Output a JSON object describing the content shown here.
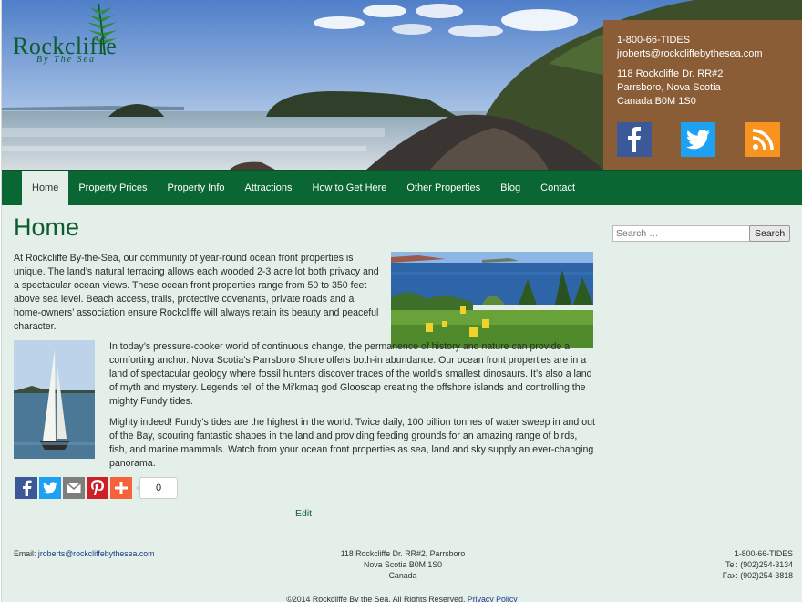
{
  "brand": {
    "logo_name": "Rockcliffe",
    "logo_tagline": "By The Sea"
  },
  "header_contact": {
    "phone": "1-800-66-TIDES",
    "email": "jroberts@rockcliffebythesea.com",
    "address1": "118 Rockcliffe Dr. RR#2",
    "address2": "Parrsboro, Nova Scotia",
    "address3": "Canada B0M 1S0"
  },
  "social": [
    {
      "name": "facebook-icon",
      "glyph": "f",
      "color": "#3b5998"
    },
    {
      "name": "twitter-icon",
      "glyph": "bird",
      "color": "#1da1f2"
    },
    {
      "name": "rss-icon",
      "glyph": "rss",
      "color": "#f7931e"
    }
  ],
  "nav": [
    {
      "label": "Home",
      "active": true
    },
    {
      "label": "Property Prices",
      "active": false
    },
    {
      "label": "Property Info",
      "active": false
    },
    {
      "label": "Attractions",
      "active": false
    },
    {
      "label": "How to Get Here",
      "active": false
    },
    {
      "label": "Other Properties",
      "active": false
    },
    {
      "label": "Blog",
      "active": false
    },
    {
      "label": "Contact",
      "active": false
    }
  ],
  "main": {
    "title": "Home",
    "p1": "At Rockcliffe By-the-Sea, our community of year-round ocean front properties is unique. The land’s natural terracing allows each wooded 2-3 acre lot both privacy and a spectacular ocean views. These ocean front properties range from 50 to 350 feet above sea level. Beach access, trails, protective covenants, private roads and a home-owners’ association ensure Rockcliffe will always retain its beauty and peaceful character.",
    "p2": "In today’s pressure-cooker world of continuous change, the permanence of history and nature can provide a comforting anchor. Nova Scotia’s Parrsboro Shore offers both-in abundance. Our ocean front properties are in a land of spectacular geology where fossil hunters discover traces of the world’s smallest dinosaurs. It’s also a land of myth and mystery. Legends tell of the Mi’kmaq god Glooscap creating the offshore islands and controlling the mighty Fundy tides.",
    "p3": "Mighty indeed! Fundy’s tides are the highest in the world. Twice daily, 100 billion tonnes of water sweep in and out of the Bay, scouring fantastic shapes in the land and providing feeding grounds for an amazing range of birds, fish, and marine mammals. Watch from your ocean front properties as sea, land and sky supply an ever-changing panorama.",
    "share_count": "0",
    "edit_label": "Edit"
  },
  "search": {
    "placeholder": "Search …",
    "button_label": "Search"
  },
  "footer": {
    "email_label": "Email:",
    "email": "jroberts@rockcliffebythesea.com",
    "address1": "118 Rockcliffe Dr. RR#2, Parrsboro",
    "address2": "Nova Scotia B0M 1S0",
    "address3": "Canada",
    "phone": "1-800-66-TIDES",
    "tel": "Tel: (902)254-3134",
    "fax": "Fax: (902)254-3818",
    "copyright": "©2014 Rockcliffe By the Sea. All Rights Reserved.",
    "privacy": "Privacy Policy"
  }
}
